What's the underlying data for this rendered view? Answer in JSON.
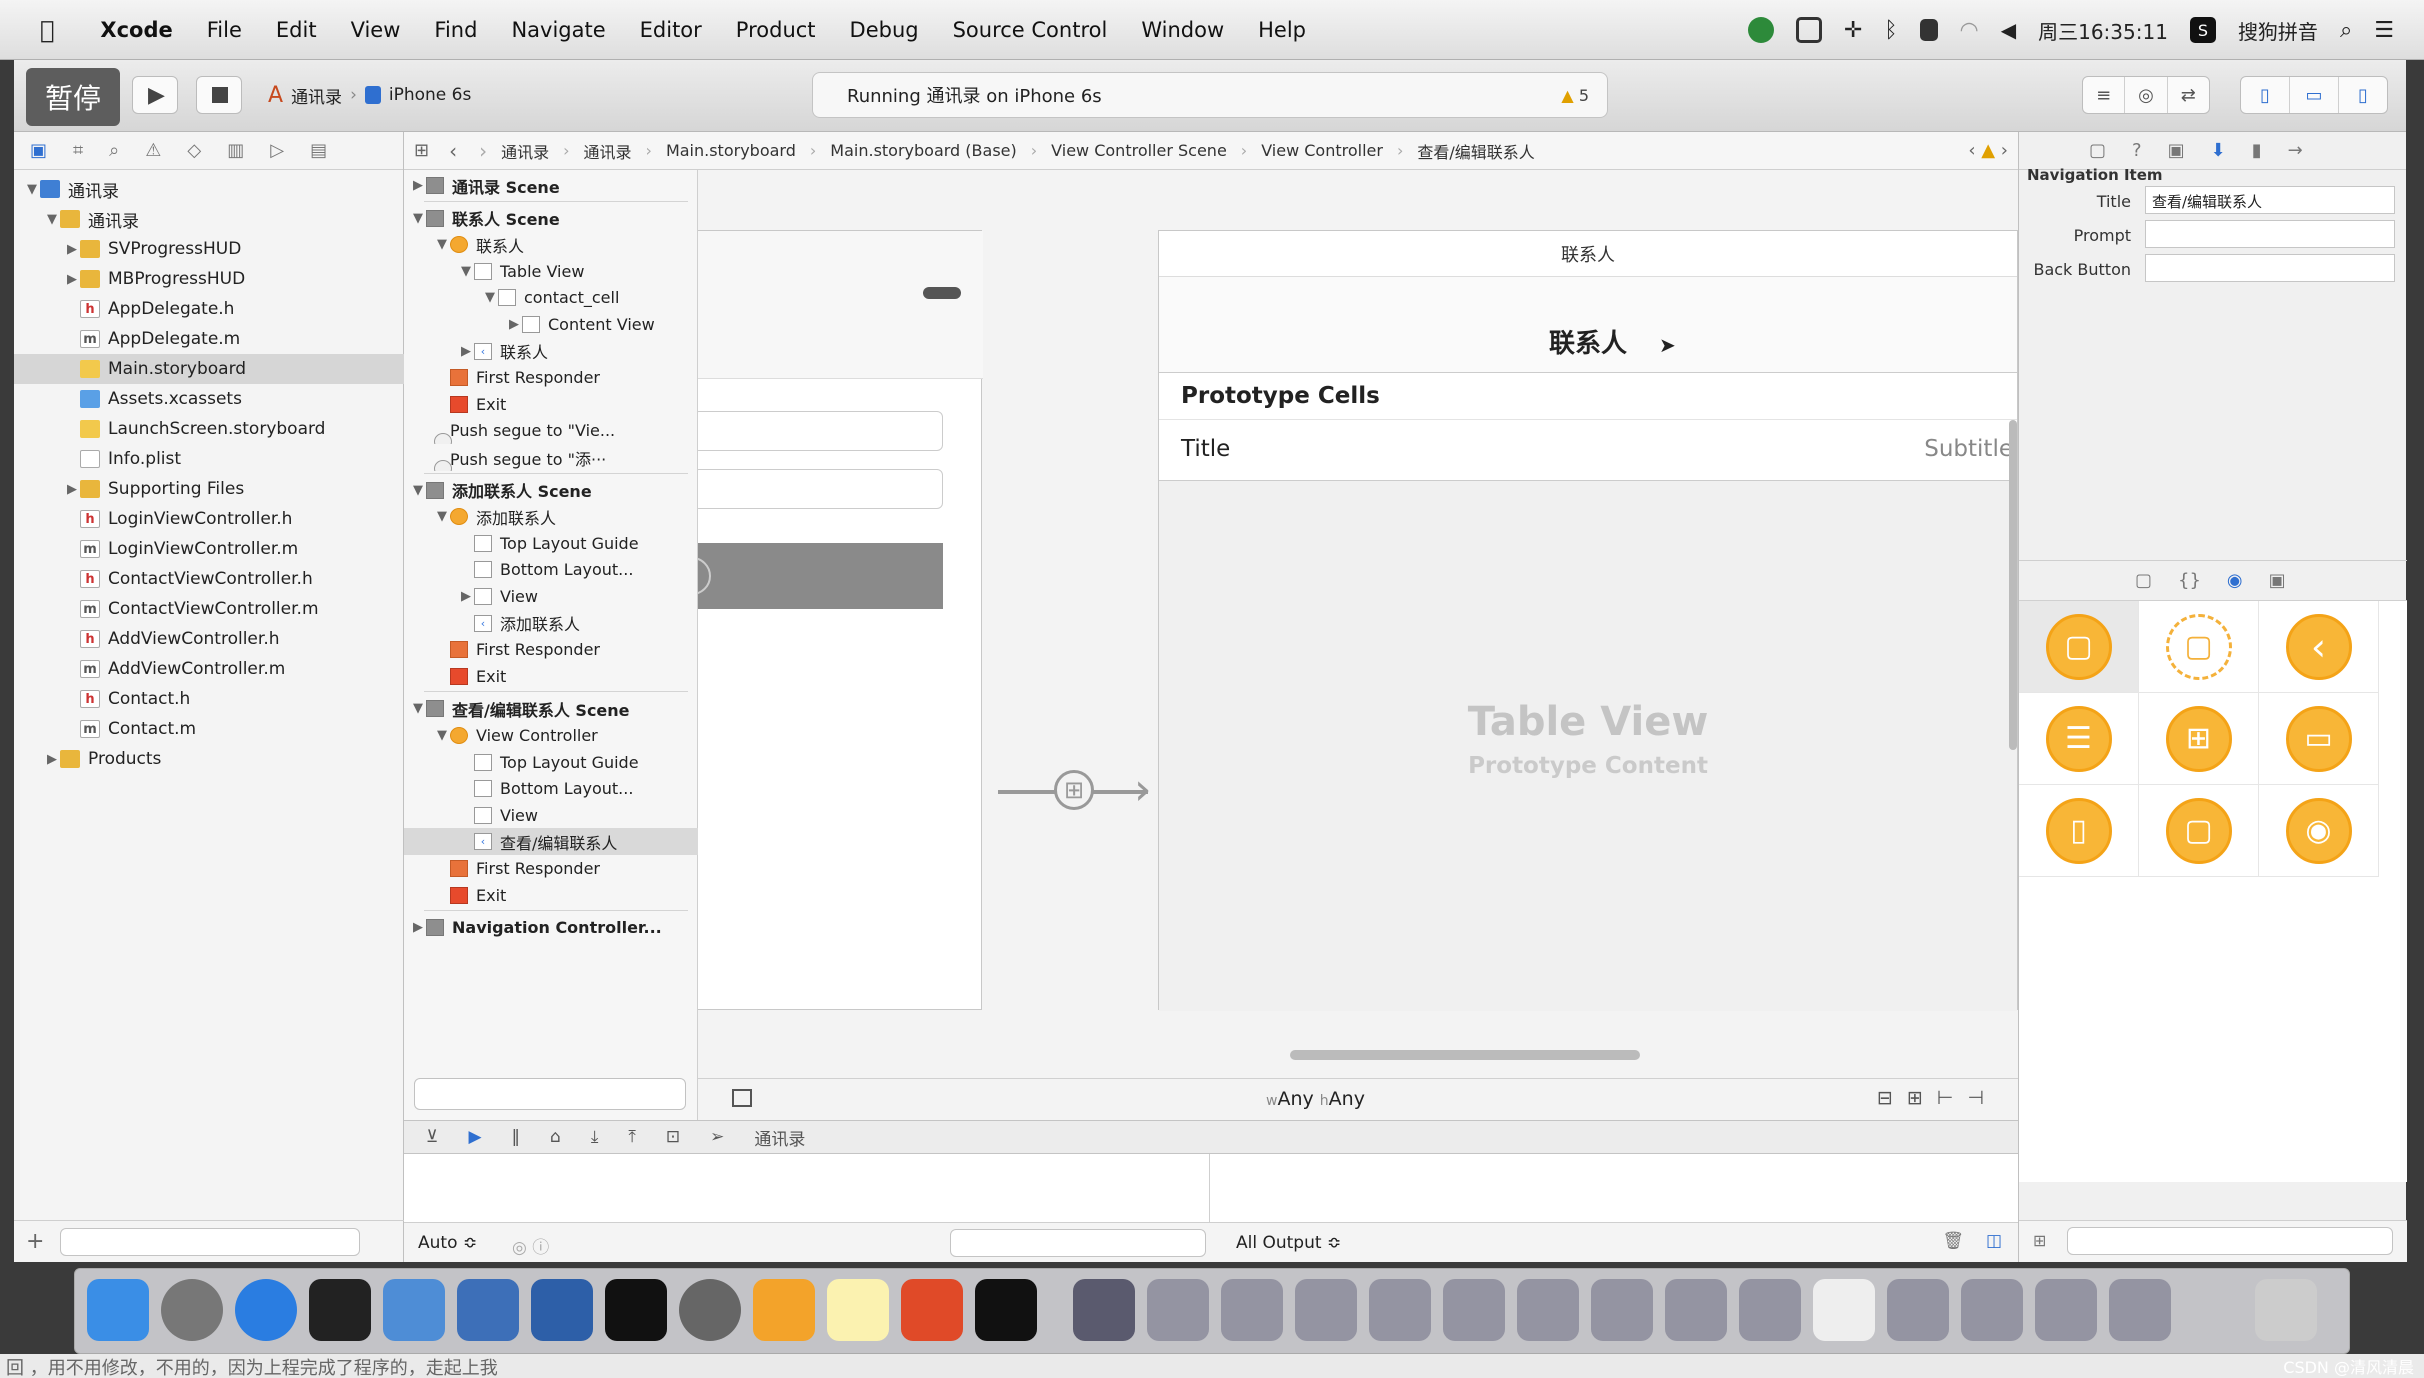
{
  "menubar": {
    "apple": "",
    "app": "Xcode",
    "items": [
      "File",
      "Edit",
      "View",
      "Find",
      "Navigate",
      "Editor",
      "Product",
      "Debug",
      "Source Control",
      "Window",
      "Help"
    ],
    "clock": "周三16:35:11",
    "input_method": "搜狗拼音"
  },
  "toolbar": {
    "pause_badge": "暂停",
    "scheme_target": "通讯录",
    "scheme_device": "iPhone 6s",
    "activity_text": "Running 通讯录 on iPhone 6s",
    "warning_count": "5"
  },
  "navigator": {
    "items": [
      {
        "label": "通讯录",
        "type": "proj",
        "indent": 0,
        "disclosure": "▼"
      },
      {
        "label": "通讯录",
        "type": "folder",
        "indent": 1,
        "disclosure": "▼"
      },
      {
        "label": "SVProgressHUD",
        "type": "folder",
        "indent": 2,
        "disclosure": "▶"
      },
      {
        "label": "MBProgressHUD",
        "type": "folder",
        "indent": 2,
        "disclosure": "▶"
      },
      {
        "label": "AppDelegate.h",
        "type": "h",
        "indent": 2,
        "disclosure": ""
      },
      {
        "label": "AppDelegate.m",
        "type": "m",
        "indent": 2,
        "disclosure": ""
      },
      {
        "label": "Main.storyboard",
        "type": "sb",
        "indent": 2,
        "disclosure": "",
        "selected": true
      },
      {
        "label": "Assets.xcassets",
        "type": "xcassets",
        "indent": 2,
        "disclosure": ""
      },
      {
        "label": "LaunchScreen.storyboard",
        "type": "sb",
        "indent": 2,
        "disclosure": ""
      },
      {
        "label": "Info.plist",
        "type": "plist",
        "indent": 2,
        "disclosure": ""
      },
      {
        "label": "Supporting Files",
        "type": "folder",
        "indent": 2,
        "disclosure": "▶"
      },
      {
        "label": "LoginViewController.h",
        "type": "h",
        "indent": 2,
        "disclosure": ""
      },
      {
        "label": "LoginViewController.m",
        "type": "m",
        "indent": 2,
        "disclosure": ""
      },
      {
        "label": "ContactViewController.h",
        "type": "h",
        "indent": 2,
        "disclosure": ""
      },
      {
        "label": "ContactViewController.m",
        "type": "m",
        "indent": 2,
        "disclosure": ""
      },
      {
        "label": "AddViewController.h",
        "type": "h",
        "indent": 2,
        "disclosure": ""
      },
      {
        "label": "AddViewController.m",
        "type": "m",
        "indent": 2,
        "disclosure": ""
      },
      {
        "label": "Contact.h",
        "type": "h",
        "indent": 2,
        "disclosure": ""
      },
      {
        "label": "Contact.m",
        "type": "m",
        "indent": 2,
        "disclosure": ""
      },
      {
        "label": "Products",
        "type": "folder",
        "indent": 1,
        "disclosure": "▶"
      }
    ]
  },
  "jumpbar": {
    "crumbs": [
      "通讯录",
      "通讯录",
      "Main.storyboard",
      "Main.storyboard (Base)",
      "View Controller Scene",
      "View Controller",
      "查看/编辑联系人"
    ]
  },
  "outline": {
    "rows": [
      {
        "label": "通讯录 Scene",
        "type": "scn",
        "indent": 0,
        "disclosure": "▶",
        "bold": true
      },
      {
        "label": "联系人 Scene",
        "type": "scn",
        "indent": 0,
        "disclosure": "▼",
        "bold": true
      },
      {
        "label": "联系人",
        "type": "vc",
        "indent": 1,
        "disclosure": "▼"
      },
      {
        "label": "Table View",
        "type": "view",
        "indent": 2,
        "disclosure": "▼"
      },
      {
        "label": "contact_cell",
        "type": "view",
        "indent": 3,
        "disclosure": "▼"
      },
      {
        "label": "Content View",
        "type": "view",
        "indent": 4,
        "disclosure": "▶"
      },
      {
        "label": "联系人",
        "type": "ni",
        "indent": 2,
        "disclosure": "▶"
      },
      {
        "label": "First Responder",
        "type": "fr",
        "indent": 1,
        "disclosure": ""
      },
      {
        "label": "Exit",
        "type": "ex",
        "indent": 1,
        "disclosure": ""
      },
      {
        "label": "Push segue to \"Vie...",
        "type": "seg",
        "indent": 1,
        "disclosure": ""
      },
      {
        "label": "Push segue to \"添···",
        "type": "seg",
        "indent": 1,
        "disclosure": ""
      },
      {
        "label": "添加联系人 Scene",
        "type": "scn",
        "indent": 0,
        "disclosure": "▼",
        "bold": true
      },
      {
        "label": "添加联系人",
        "type": "vc",
        "indent": 1,
        "disclosure": "▼"
      },
      {
        "label": "Top Layout Guide",
        "type": "view",
        "indent": 2,
        "disclosure": ""
      },
      {
        "label": "Bottom Layout...",
        "type": "view",
        "indent": 2,
        "disclosure": ""
      },
      {
        "label": "View",
        "type": "view",
        "indent": 2,
        "disclosure": "▶"
      },
      {
        "label": "添加联系人",
        "type": "ni",
        "indent": 2,
        "disclosure": ""
      },
      {
        "label": "First Responder",
        "type": "fr",
        "indent": 1,
        "disclosure": ""
      },
      {
        "label": "Exit",
        "type": "ex",
        "indent": 1,
        "disclosure": ""
      },
      {
        "label": "查看/编辑联系人 Scene",
        "type": "scn",
        "indent": 0,
        "disclosure": "▼",
        "bold": true
      },
      {
        "label": "View Controller",
        "type": "vc",
        "indent": 1,
        "disclosure": "▼"
      },
      {
        "label": "Top Layout Guide",
        "type": "view",
        "indent": 2,
        "disclosure": ""
      },
      {
        "label": "Bottom Layout...",
        "type": "view",
        "indent": 2,
        "disclosure": ""
      },
      {
        "label": "View",
        "type": "view",
        "indent": 2,
        "disclosure": ""
      },
      {
        "label": "查看/编辑联系人",
        "type": "ni",
        "indent": 2,
        "disclosure": "",
        "selected": true
      },
      {
        "label": "First Responder",
        "type": "fr",
        "indent": 1,
        "disclosure": ""
      },
      {
        "label": "Exit",
        "type": "ex",
        "indent": 1,
        "disclosure": ""
      },
      {
        "label": "Navigation Controller...",
        "type": "scn",
        "indent": 0,
        "disclosure": "▶",
        "bold": true
      }
    ]
  },
  "canvas": {
    "contact_scene_title": "联系人",
    "nav_title": "联系人",
    "prototype_header": "Prototype Cells",
    "cell_title": "Title",
    "cell_subtitle": "Subtitle",
    "tv_placeholder_title": "Table View",
    "tv_placeholder_sub": "Prototype Content",
    "size_w_prefix": "w",
    "size_w": "Any",
    "size_h_prefix": "h",
    "size_h": "Any"
  },
  "debug": {
    "target": "通讯录",
    "auto_label": "Auto ≎",
    "output_label": "All Output ≎"
  },
  "inspector": {
    "section": "Navigation Item",
    "fields": [
      {
        "label": "Title",
        "value": "查看/编辑联系人"
      },
      {
        "label": "Prompt",
        "value": ""
      },
      {
        "label": "Back Button",
        "value": ""
      }
    ]
  },
  "footer": {
    "text_left": "回 ，用不用修改，不用的，因为上程完成了程序的，走起上我",
    "watermark": "CSDN @清风清晨"
  }
}
